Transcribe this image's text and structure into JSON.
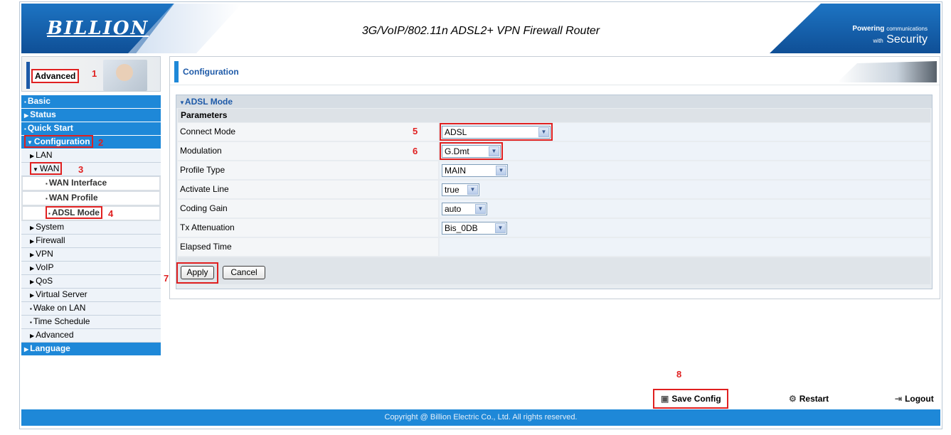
{
  "header": {
    "logo": "BILLION",
    "product_title": "3G/VoIP/802.11n ADSL2+ VPN Firewall Router",
    "tagline_1": "Powering",
    "tagline_1_small": "communications",
    "tagline_2_small": "with",
    "tagline_2": "Security"
  },
  "sidebar": {
    "mode_label": "Advanced",
    "items": [
      {
        "label": "Basic"
      },
      {
        "label": "Status"
      },
      {
        "label": "Quick Start"
      },
      {
        "label": "Configuration"
      },
      {
        "label": "LAN"
      },
      {
        "label": "WAN"
      },
      {
        "label": "WAN Interface"
      },
      {
        "label": "WAN Profile"
      },
      {
        "label": "ADSL Mode"
      },
      {
        "label": "System"
      },
      {
        "label": "Firewall"
      },
      {
        "label": "VPN"
      },
      {
        "label": "VoIP"
      },
      {
        "label": "QoS"
      },
      {
        "label": "Virtual Server"
      },
      {
        "label": "Wake on LAN"
      },
      {
        "label": "Time Schedule"
      },
      {
        "label": "Advanced"
      },
      {
        "label": "Language"
      }
    ]
  },
  "content": {
    "title": "Configuration",
    "panel_title": "ADSL Mode",
    "params_header": "Parameters",
    "fields": [
      {
        "label": "Connect Mode",
        "value": "ADSL"
      },
      {
        "label": "Modulation",
        "value": "G.Dmt"
      },
      {
        "label": "Profile Type",
        "value": "MAIN"
      },
      {
        "label": "Activate Line",
        "value": "true"
      },
      {
        "label": "Coding Gain",
        "value": "auto"
      },
      {
        "label": "Tx Attenuation",
        "value": "Bis_0DB"
      },
      {
        "label": "Elapsed Time",
        "value": ""
      }
    ],
    "apply_label": "Apply",
    "cancel_label": "Cancel"
  },
  "footer": {
    "save_config": "Save Config",
    "restart": "Restart",
    "logout": "Logout",
    "copyright": "Copyright @ Billion Electric Co., Ltd. All rights reserved."
  },
  "steps": [
    "1",
    "2",
    "3",
    "4",
    "5",
    "6",
    "7",
    "8"
  ],
  "colors": {
    "nav_blue": "#1e88d8",
    "brand_blue": "#1e5aa8",
    "highlight_red": "#e02020"
  }
}
